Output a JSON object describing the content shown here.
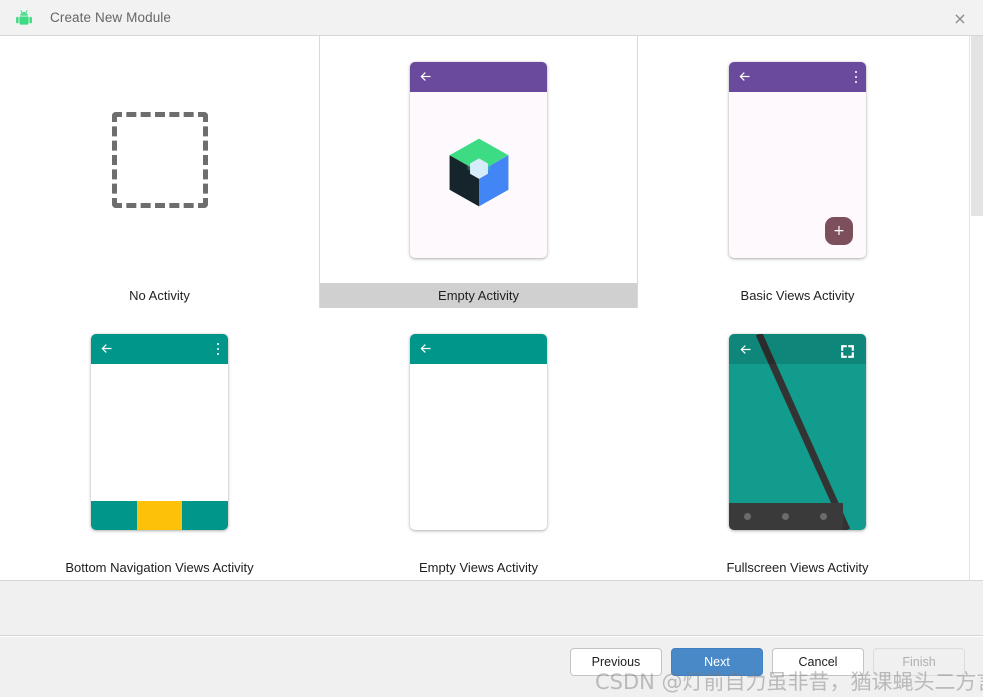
{
  "window": {
    "title": "Create New Module",
    "app_icon": "android-robot-icon",
    "close_label": "×"
  },
  "gallery": {
    "scrollbar": {
      "orientation": "vertical",
      "thumb_position": "top"
    },
    "templates": [
      {
        "id": "no-activity",
        "label": "No Activity",
        "selected": false,
        "thumb": "dashed-square-placeholder"
      },
      {
        "id": "empty-activity",
        "label": "Empty Activity",
        "selected": true,
        "thumb": "phone-compose-logo",
        "appbar_color": "#6a4a9c",
        "body_color": "#fdf9fd",
        "icons": [
          "back-arrow-icon",
          "jetpack-compose-logo-icon"
        ]
      },
      {
        "id": "basic-views-activity",
        "label": "Basic Views Activity",
        "selected": false,
        "thumb": "phone-with-fab",
        "appbar_color": "#6a4a9c",
        "body_color": "#fdf9fd",
        "fab_color": "#7d4f5d",
        "fab_label": "+",
        "icons": [
          "back-arrow-icon",
          "overflow-menu-icon",
          "plus-icon"
        ]
      },
      {
        "id": "bottom-navigation-views-activity",
        "label": "Bottom Navigation Views Activity",
        "selected": false,
        "thumb": "phone-with-bottom-nav",
        "appbar_color": "#00968a",
        "body_color": "#ffffff",
        "nav_colors": [
          "#00968a",
          "#fdc10a",
          "#00968a"
        ],
        "icons": [
          "back-arrow-icon",
          "overflow-menu-icon"
        ]
      },
      {
        "id": "empty-views-activity",
        "label": "Empty Views Activity",
        "selected": false,
        "thumb": "phone-plain",
        "appbar_color": "#00968a",
        "body_color": "#ffffff",
        "icons": [
          "back-arrow-icon"
        ]
      },
      {
        "id": "fullscreen-views-activity",
        "label": "Fullscreen Views Activity",
        "selected": false,
        "thumb": "phone-fullscreen",
        "body_color": "#119c8e",
        "navbar_color": "#3a3a3a",
        "icons": [
          "back-arrow-icon",
          "fullscreen-expand-icon"
        ]
      }
    ]
  },
  "buttons": {
    "previous": "Previous",
    "next": "Next",
    "cancel": "Cancel",
    "finish": "Finish"
  },
  "colors": {
    "accent": "#4989c8",
    "selection": "#d0d0d0",
    "panel": "#f0f0f0",
    "titlebar": "#f2f2f2"
  },
  "watermark": {
    "text": "CSDN @灯前自力虽非昔，猶课蝇头二方言。"
  }
}
